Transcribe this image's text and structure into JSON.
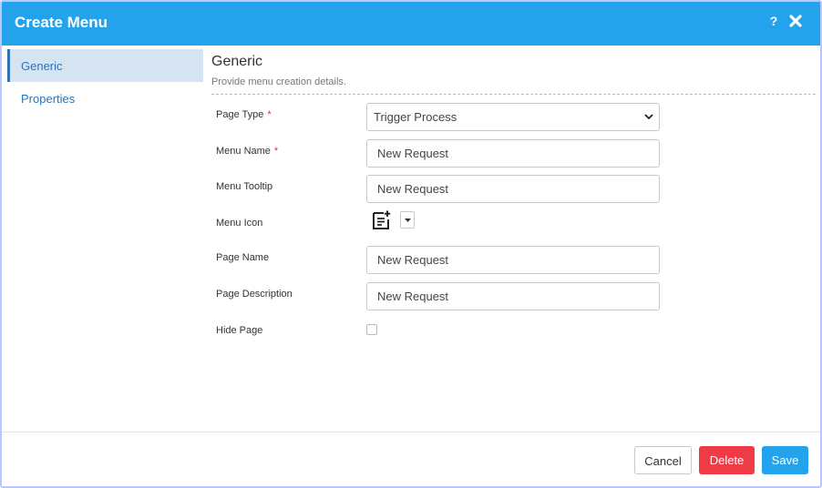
{
  "dialog": {
    "title": "Create Menu",
    "help_label": "?"
  },
  "sidebar": {
    "items": [
      {
        "label": "Generic",
        "active": true
      },
      {
        "label": "Properties",
        "active": false
      }
    ]
  },
  "section": {
    "title": "Generic",
    "subtitle": "Provide menu creation details."
  },
  "form": {
    "page_type": {
      "label": "Page Type",
      "required_mark": "*",
      "value": "Trigger Process"
    },
    "menu_name": {
      "label": "Menu Name",
      "required_mark": "*",
      "value": "New Request"
    },
    "menu_tooltip": {
      "label": "Menu Tooltip",
      "value": "New Request"
    },
    "menu_icon": {
      "label": "Menu Icon",
      "icon": "note-add-icon"
    },
    "page_name": {
      "label": "Page Name",
      "value": "New Request"
    },
    "page_description": {
      "label": "Page Description",
      "value": "New Request"
    },
    "hide_page": {
      "label": "Hide Page",
      "checked": false
    }
  },
  "footer": {
    "cancel_label": "Cancel",
    "delete_label": "Delete",
    "save_label": "Save"
  },
  "colors": {
    "header": "#22a3eb",
    "accent_link": "#2a74b6",
    "delete": "#ef3b45",
    "save": "#22a3eb",
    "required": "#e03131"
  }
}
